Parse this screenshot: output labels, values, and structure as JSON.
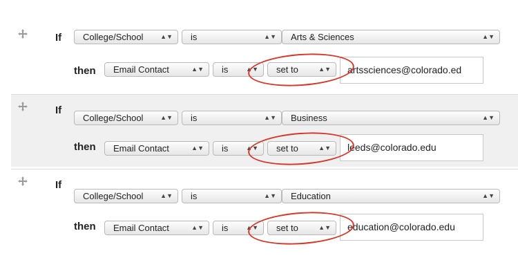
{
  "icons": {
    "move_handle": "move-handle-icon",
    "select_arrows": "up-down-arrows-icon"
  },
  "keywords": {
    "if": "If",
    "then": "then"
  },
  "arrow_glyph": "▲▼",
  "highlight_color": "#d3382b",
  "rules": [
    {
      "condition_field": "College/School",
      "condition_operator": "is",
      "condition_value": "Arts & Sciences",
      "action_field": "Email Contact",
      "action_operator": "is",
      "action_mode": "set to",
      "action_value": "artssciences@colorado.ed"
    },
    {
      "condition_field": "College/School",
      "condition_operator": "is",
      "condition_value": "Business",
      "action_field": "Email Contact",
      "action_operator": "is",
      "action_mode": "set to",
      "action_value": "leeds@colorado.edu"
    },
    {
      "condition_field": "College/School",
      "condition_operator": "is",
      "condition_value": "Education",
      "action_field": "Email Contact",
      "action_operator": "is",
      "action_mode": "set to",
      "action_value": "education@colorado.edu"
    }
  ]
}
